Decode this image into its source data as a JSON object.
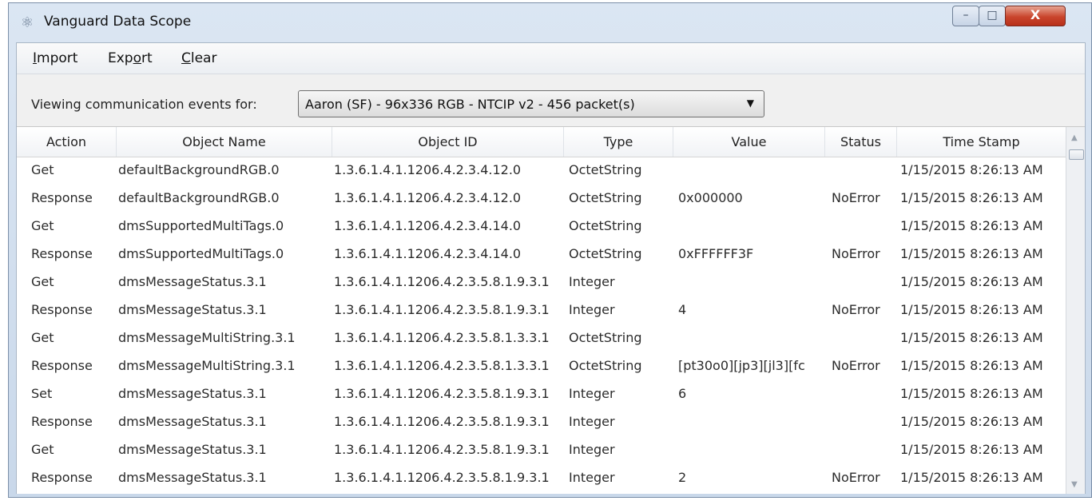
{
  "window": {
    "title": "Vanguard Data Scope",
    "app_icon": "atom-icon",
    "controls": {
      "minimize": "–",
      "maximize": "□",
      "close": "X"
    }
  },
  "menu": {
    "items": [
      {
        "accel": "I",
        "rest": "mport"
      },
      {
        "pre": "Exp",
        "accel": "o",
        "rest": "rt"
      },
      {
        "accel": "C",
        "rest": "lear"
      }
    ]
  },
  "filter": {
    "label": "Viewing communication events for:",
    "selected": "Aaron (SF) - 96x336 RGB - NTCIP v2 - 456 packet(s)"
  },
  "table": {
    "columns": [
      "Action",
      "Object Name",
      "Object ID",
      "Type",
      "Value",
      "Status",
      "Time Stamp"
    ],
    "rows": [
      [
        "Get",
        "defaultBackgroundRGB.0",
        "1.3.6.1.4.1.1206.4.2.3.4.12.0",
        "OctetString",
        "",
        "",
        "1/15/2015 8:26:13 AM"
      ],
      [
        "Response",
        "defaultBackgroundRGB.0",
        "1.3.6.1.4.1.1206.4.2.3.4.12.0",
        "OctetString",
        "0x000000",
        "NoError",
        "1/15/2015 8:26:13 AM"
      ],
      [
        "Get",
        "dmsSupportedMultiTags.0",
        "1.3.6.1.4.1.1206.4.2.3.4.14.0",
        "OctetString",
        "",
        "",
        "1/15/2015 8:26:13 AM"
      ],
      [
        "Response",
        "dmsSupportedMultiTags.0",
        "1.3.6.1.4.1.1206.4.2.3.4.14.0",
        "OctetString",
        "0xFFFFFF3F",
        "NoError",
        "1/15/2015 8:26:13 AM"
      ],
      [
        "Get",
        "dmsMessageStatus.3.1",
        "1.3.6.1.4.1.1206.4.2.3.5.8.1.9.3.1",
        "Integer",
        "",
        "",
        "1/15/2015 8:26:13 AM"
      ],
      [
        "Response",
        "dmsMessageStatus.3.1",
        "1.3.6.1.4.1.1206.4.2.3.5.8.1.9.3.1",
        "Integer",
        "4",
        "NoError",
        "1/15/2015 8:26:13 AM"
      ],
      [
        "Get",
        "dmsMessageMultiString.3.1",
        "1.3.6.1.4.1.1206.4.2.3.5.8.1.3.3.1",
        "OctetString",
        "",
        "",
        "1/15/2015 8:26:13 AM"
      ],
      [
        "Response",
        "dmsMessageMultiString.3.1",
        "1.3.6.1.4.1.1206.4.2.3.5.8.1.3.3.1",
        "OctetString",
        "[pt30o0][jp3][jl3][fc",
        "NoError",
        "1/15/2015 8:26:13 AM"
      ],
      [
        "Set",
        "dmsMessageStatus.3.1",
        "1.3.6.1.4.1.1206.4.2.3.5.8.1.9.3.1",
        "Integer",
        "6",
        "",
        "1/15/2015 8:26:13 AM"
      ],
      [
        "Response",
        "dmsMessageStatus.3.1",
        "1.3.6.1.4.1.1206.4.2.3.5.8.1.9.3.1",
        "Integer",
        "",
        "",
        "1/15/2015 8:26:13 AM"
      ],
      [
        "Get",
        "dmsMessageStatus.3.1",
        "1.3.6.1.4.1.1206.4.2.3.5.8.1.9.3.1",
        "Integer",
        "",
        "",
        "1/15/2015 8:26:13 AM"
      ],
      [
        "Response",
        "dmsMessageStatus.3.1",
        "1.3.6.1.4.1.1206.4.2.3.5.8.1.9.3.1",
        "Integer",
        "2",
        "NoError",
        "1/15/2015 8:26:13 AM"
      ]
    ]
  }
}
